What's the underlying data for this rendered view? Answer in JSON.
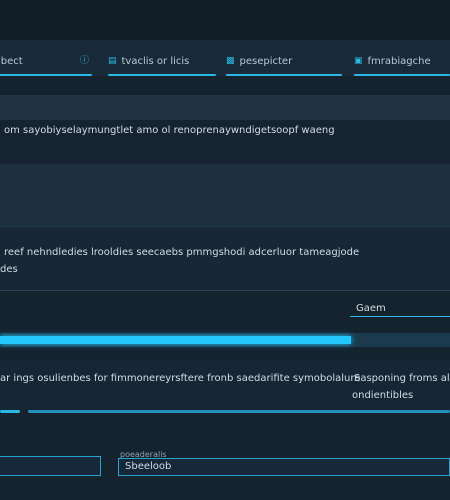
{
  "tabs": [
    {
      "label": "ibect",
      "icon": "doc-icon"
    },
    {
      "label": "",
      "icon": "info-icon"
    },
    {
      "label": "tvaclis or licis",
      "icon": "list-icon"
    },
    {
      "label": "pesepicter",
      "icon": "shield-icon"
    },
    {
      "label": "fmrabiagche",
      "icon": "gift-icon"
    }
  ],
  "rows": {
    "heading": "om sayobiyselaymungtlet amo ol renoprenaywndigetsoopf waeng",
    "para1": "reef nehndledies lrooldies seecaebs pmmgshodi adcerluor tameagjode",
    "para2": "des",
    "label_right": "Gaem",
    "row3": "ar ings osulienbes for fimmonereyrsftere fronb saedarifite symobolalure",
    "row3_right": "Sasponing froms ale",
    "row3_right2": "ondientibles"
  },
  "progress": {
    "fraction": 0.78
  },
  "fields": {
    "small_label": "poeaderalis",
    "input_value": "Sbeeloob"
  },
  "colors": {
    "accent": "#2bb8e6",
    "bg": "#15232f"
  }
}
